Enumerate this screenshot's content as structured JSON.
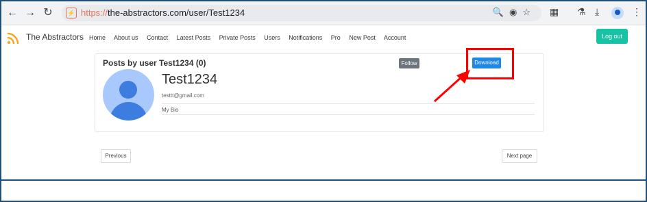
{
  "browser": {
    "url_scheme": "https://",
    "url_rest": "the-abstractors.com/user/Test1234"
  },
  "site": {
    "brand": "The Abstractors",
    "menu": [
      "Home",
      "About us",
      "Contact",
      "Latest Posts",
      "Private Posts",
      "Users",
      "Notifications",
      "Pro",
      "New Post",
      "Account"
    ],
    "logout_label": "Log out"
  },
  "profile": {
    "posts_title": "Posts by user Test1234 (0)",
    "follow_label": "Follow",
    "download_label": "Download",
    "username": "Test1234",
    "email": "testtt@gmail.com",
    "bio": "My Bio"
  },
  "pagination": {
    "previous_label": "Previous",
    "next_label": "Next page"
  },
  "colors": {
    "logout": "#17c3a4",
    "download": "#1e88e5",
    "follow": "#6c757d",
    "highlight": "#ff0000",
    "frame": "#1f4e79"
  }
}
